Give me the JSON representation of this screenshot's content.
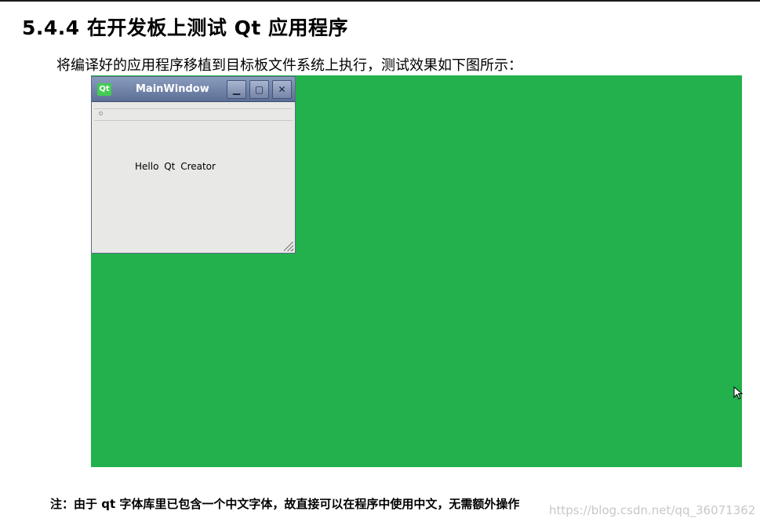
{
  "section": {
    "heading": "5.4.4  在开发板上测试 Qt  应用程序",
    "intro": "将编译好的应用程序移植到目标板文件系统上执行，测试效果如下图所示："
  },
  "screenshot": {
    "background_color": "#22b14c",
    "window": {
      "logo_text": "Qt",
      "title": "MainWindow",
      "minimize_symbol": "▁",
      "maximize_symbol": "▢",
      "close_symbol": "✕",
      "label_text": "Hello  Qt  Creator"
    }
  },
  "note": "注：由于 qt 字体库里已包含一个中文字体，故直接可以在程序中使用中文，无需额外操作",
  "watermark": "https://blog.csdn.net/qq_36071362"
}
